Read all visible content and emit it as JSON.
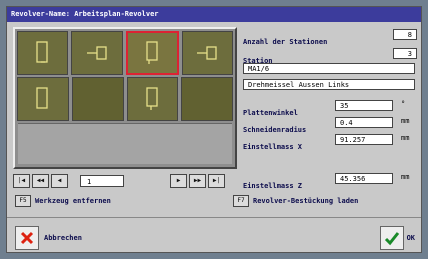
{
  "window": {
    "title": "Revolver-Name: Arbeitsplan-Revolver"
  },
  "pager": {
    "first": "|◀",
    "prev_fast": "◀◀",
    "prev": "◀",
    "page": "1",
    "next": "▶",
    "next_fast": "▶▶",
    "last": "▶|"
  },
  "fields": {
    "anzahl_label": "Anzahl der Stationen",
    "anzahl_value": "8",
    "station_label": "Station",
    "station_value": "3",
    "tool_name": "MA1/6",
    "tool_desc": "Drehmeissel Aussen Links",
    "plattenwinkel_label": "Plattenwinkel",
    "plattenwinkel_value": "35",
    "schneidenradius_label": "Schneidenradius",
    "schneidenradius_value": "0.4",
    "einstellmass_x_label": "Einstellmass X",
    "einstellmass_x_value": "91.257",
    "einstellmass_z_label": "Einstellmass Z",
    "einstellmass_z_value": "45.356",
    "unit_deg": "°",
    "unit_mm": "mm"
  },
  "actions": {
    "remove_label": "Werkzeug entfernen",
    "remove_key": "F5",
    "load_label": "Revolver-Bestückung laden",
    "load_key": "F7",
    "cancel_label": "Abbrechen",
    "ok_label": "OK"
  },
  "colors": {
    "title_bg": "#3c3c9c",
    "panel": "#c9c9c9",
    "selected_border": "#d23",
    "tool": "#e6e08a"
  }
}
